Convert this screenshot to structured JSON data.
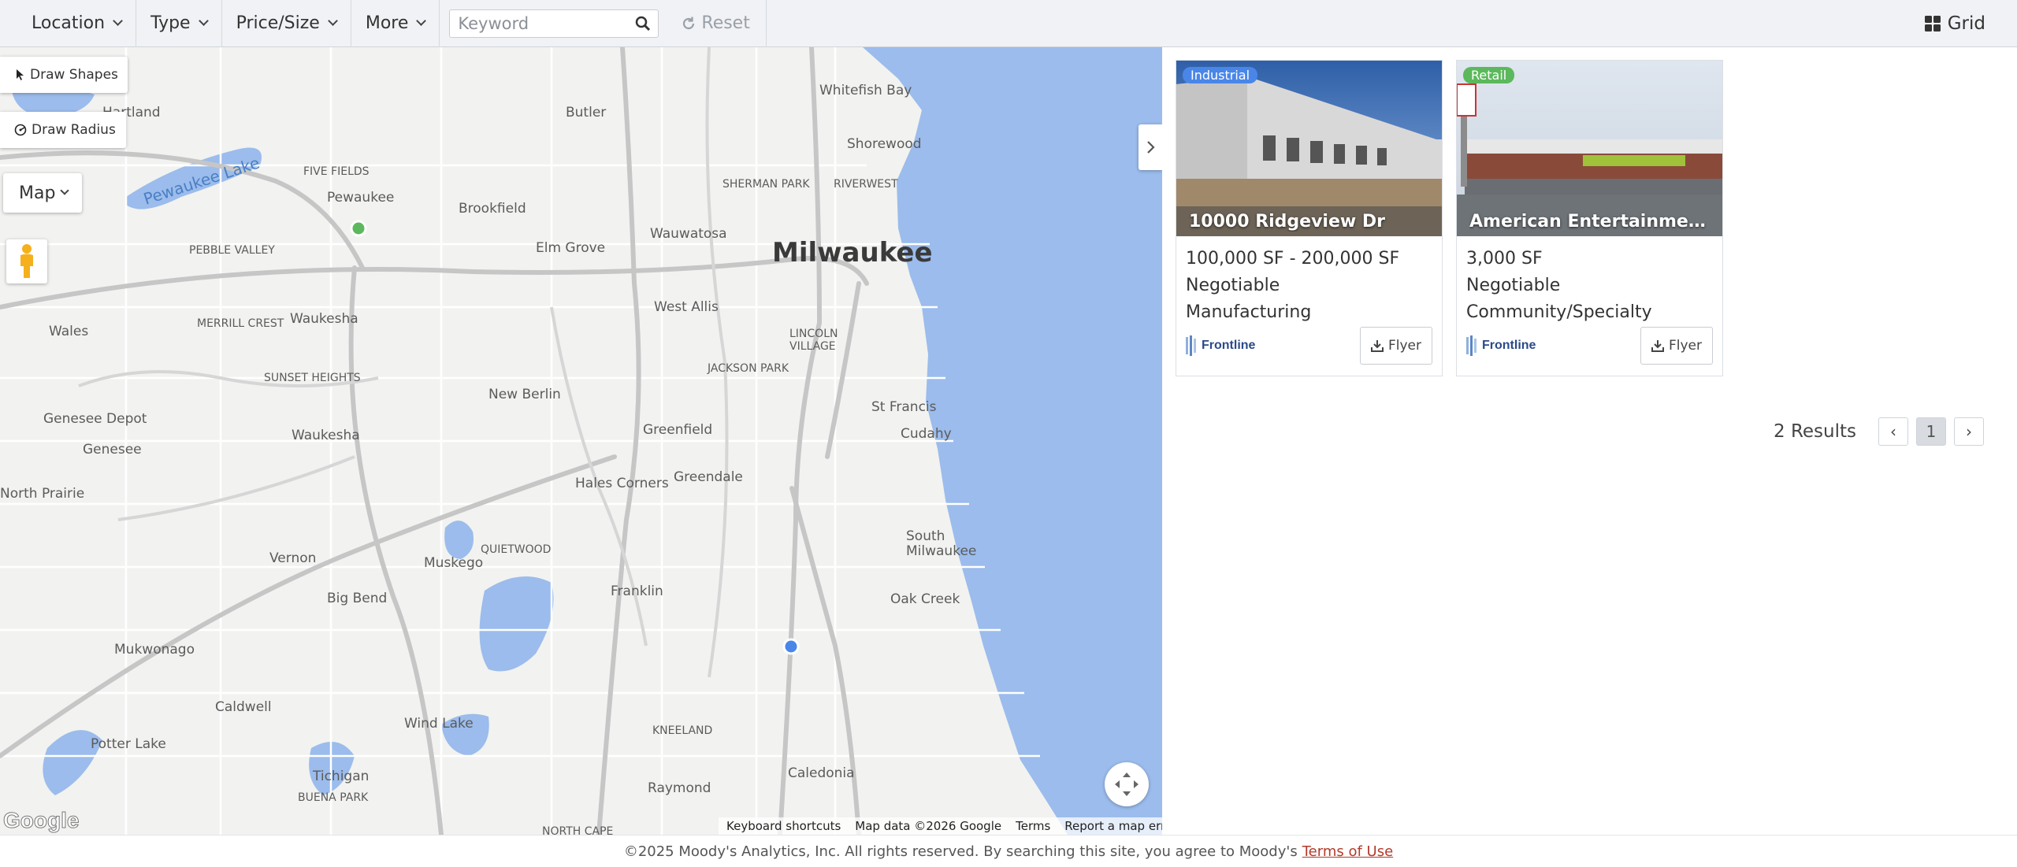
{
  "toolbar": {
    "filters": [
      {
        "label": "Location"
      },
      {
        "label": "Type"
      },
      {
        "label": "Price/Size"
      },
      {
        "label": "More"
      }
    ],
    "keyword_placeholder": "Keyword",
    "keyword_value": "",
    "reset_label": "Reset",
    "view_label": "Grid",
    "icons": {
      "search": "search-icon",
      "reset": "refresh-icon",
      "grid": "grid-icon"
    }
  },
  "map": {
    "draw_shapes_label": "Draw Shapes",
    "draw_radius_label": "Draw Radius",
    "map_type_label": "Map",
    "google_logo": "Google",
    "attribution": {
      "shortcuts": "Keyboard shortcuts",
      "data": "Map data ©2026 Google",
      "terms": "Terms",
      "report": "Report a map error"
    },
    "labels": {
      "milwaukee": "Milwaukee",
      "pewaukee_lake": "Pewaukee Lake",
      "places": [
        "Hartland",
        "Butler",
        "Whitefish Bay",
        "Shorewood",
        "FIVE FIELDS",
        "Pewaukee",
        "Brookfield",
        "SHERMAN PARK",
        "RIVERWEST",
        "Wauwatosa",
        "Elm Grove",
        "PEBBLE VALLEY",
        "Waukesha",
        "MERRILL CREST",
        "West Allis",
        "Wales",
        "SUNSET HEIGHTS",
        "LINCOLN VILLAGE",
        "JACKSON PARK",
        "New Berlin",
        "Genesee Depot",
        "Greenfield",
        "St Francis",
        "Cudahy",
        "Waukesha",
        "Genesee",
        "Hales Corners",
        "Greendale",
        "North Prairie",
        "South Milwaukee",
        "QUIETWOOD",
        "Vernon",
        "Muskego",
        "Franklin",
        "Oak Creek",
        "Big Bend",
        "Mukwonago",
        "Caldwell",
        "Wind Lake",
        "KNEELAND",
        "Potter Lake",
        "Caledonia",
        "Raymond",
        "Tichigan",
        "BUENA PARK",
        "NORTH CAPE"
      ]
    }
  },
  "listings": [
    {
      "badge": "Industrial",
      "badge_color": "#4a86e8",
      "title": "10000 Ridgeview Dr",
      "size": "100,000 SF - 200,000 SF",
      "price": "Negotiable",
      "subtype": "Manufacturing",
      "broker": "Frontline",
      "flyer_label": "Flyer"
    },
    {
      "badge": "Retail",
      "badge_color": "#5cb85c",
      "title": "American Entertainment ...",
      "size": "3,000 SF",
      "price": "Negotiable",
      "subtype": "Community/Specialty",
      "broker": "Frontline",
      "flyer_label": "Flyer"
    }
  ],
  "pagination": {
    "results_text": "2 Results",
    "prev": "‹",
    "current": "1",
    "next": "›"
  },
  "footer": {
    "text": "©2025 Moody's Analytics, Inc. All rights reserved. By searching this site, you agree to Moody's",
    "link": "Terms of Use"
  },
  "colors": {
    "water": "#9bbcec",
    "land": "#f2f2f0",
    "road": "#ffffff",
    "highway": "#c9c9c9",
    "accent_link": "#b23b2b"
  }
}
